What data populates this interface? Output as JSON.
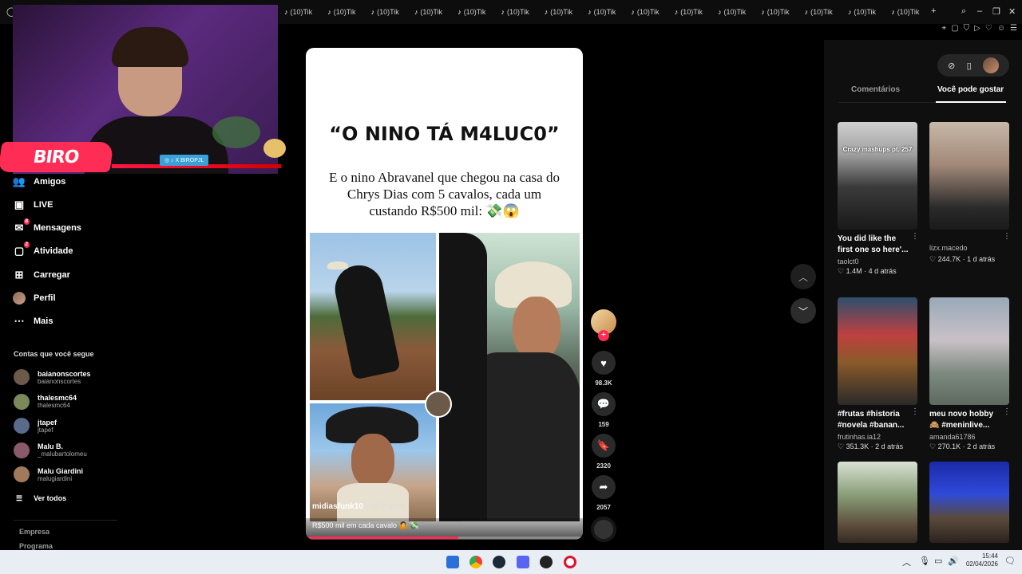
{
  "browser": {
    "tabs": [
      "(10)Tik",
      "(10)Tik",
      "(10)Tik",
      "(10)Tik",
      "(10)Tik",
      "(10)Tik",
      "(10)Tik",
      "(10)Tik",
      "(10)Tik",
      "(10)Tik",
      "(10)Tik",
      "(10)Tik",
      "(10)Tik",
      "(10)Tik",
      "(10)Tik"
    ],
    "new_tab": "+",
    "controls": [
      "search-icon",
      "minimize-icon",
      "restore-icon",
      "close-icon"
    ]
  },
  "webcam": {
    "logo_text": "BIRO",
    "social_tag": "◎ ♪ X  BIROPJL"
  },
  "sidebar": {
    "items": [
      {
        "label": "Amigos",
        "icon": "friends-icon",
        "badge": ""
      },
      {
        "label": "LIVE",
        "icon": "live-icon",
        "badge": ""
      },
      {
        "label": "Mensagens",
        "icon": "messages-icon",
        "badge": "8"
      },
      {
        "label": "Atividade",
        "icon": "activity-icon",
        "badge": "2"
      },
      {
        "label": "Carregar",
        "icon": "upload-icon",
        "badge": ""
      },
      {
        "label": "Perfil",
        "icon": "profile-icon",
        "badge": ""
      },
      {
        "label": "Mais",
        "icon": "more-icon",
        "badge": ""
      }
    ],
    "following_title": "Contas que você segue",
    "following": [
      {
        "name": "baianonscortes",
        "handle": "baianonscortes",
        "color": "#6b5a4a"
      },
      {
        "name": "thalesmc64",
        "handle": "thalesmc64",
        "color": "#7a8a5a"
      },
      {
        "name": "jtapef",
        "handle": "jtapef",
        "color": "#5a6a8a"
      },
      {
        "name": "Malu B.",
        "handle": "_malubartolomeu",
        "color": "#8a5a6a"
      },
      {
        "name": "Malu Giardini",
        "handle": "malugiardini",
        "color": "#a07a5a"
      }
    ],
    "see_all": "Ver todos",
    "footer": [
      "Empresa",
      "Programa"
    ]
  },
  "video": {
    "title": "“O NINO TÁ M4LUC0”",
    "subtitle": "E o nino Abravanel que chegou na casa do Chrys Dias com 5 cavalos, cada um custando R$500 mil: 💸😱",
    "author": "midiasfunk10",
    "time": " · 19 h atrás",
    "caption": "R$500 mil em cada cavalo 🤷 💸",
    "progress": 0.55
  },
  "actions": {
    "likes": "98.3K",
    "comments": "159",
    "saves": "2320",
    "shares": "2057"
  },
  "right_panel": {
    "tabs": [
      "Comentários",
      "Você pode gostar"
    ],
    "active_tab": 1,
    "recommendations": [
      {
        "title": "You did like the first one so here'...",
        "user": "taolct0",
        "likes": "1.4M",
        "time": "4 d atrás",
        "thumb_caption": "Crazy mashups pt. 257"
      },
      {
        "title": "",
        "user": "lizx.macedo",
        "likes": "244.7K",
        "time": "1 d atrás",
        "thumb_caption": ""
      },
      {
        "title": "#frutas #historia #novela #banan...",
        "user": "frutinhas.ia12",
        "likes": "351.3K",
        "time": "2 d atrás",
        "thumb_caption": ""
      },
      {
        "title": "meu novo hobby 🙈 #meninlive...",
        "user": "amanda61786",
        "likes": "270.1K",
        "time": "2 d atrás",
        "thumb_caption": ""
      },
      {
        "title": "",
        "user": "",
        "likes": "",
        "time": "",
        "thumb_caption": ""
      },
      {
        "title": "",
        "user": "",
        "likes": "",
        "time": "",
        "thumb_caption": ""
      }
    ]
  },
  "taskbar": {
    "time": "15:44",
    "date": "02/04/2026"
  }
}
